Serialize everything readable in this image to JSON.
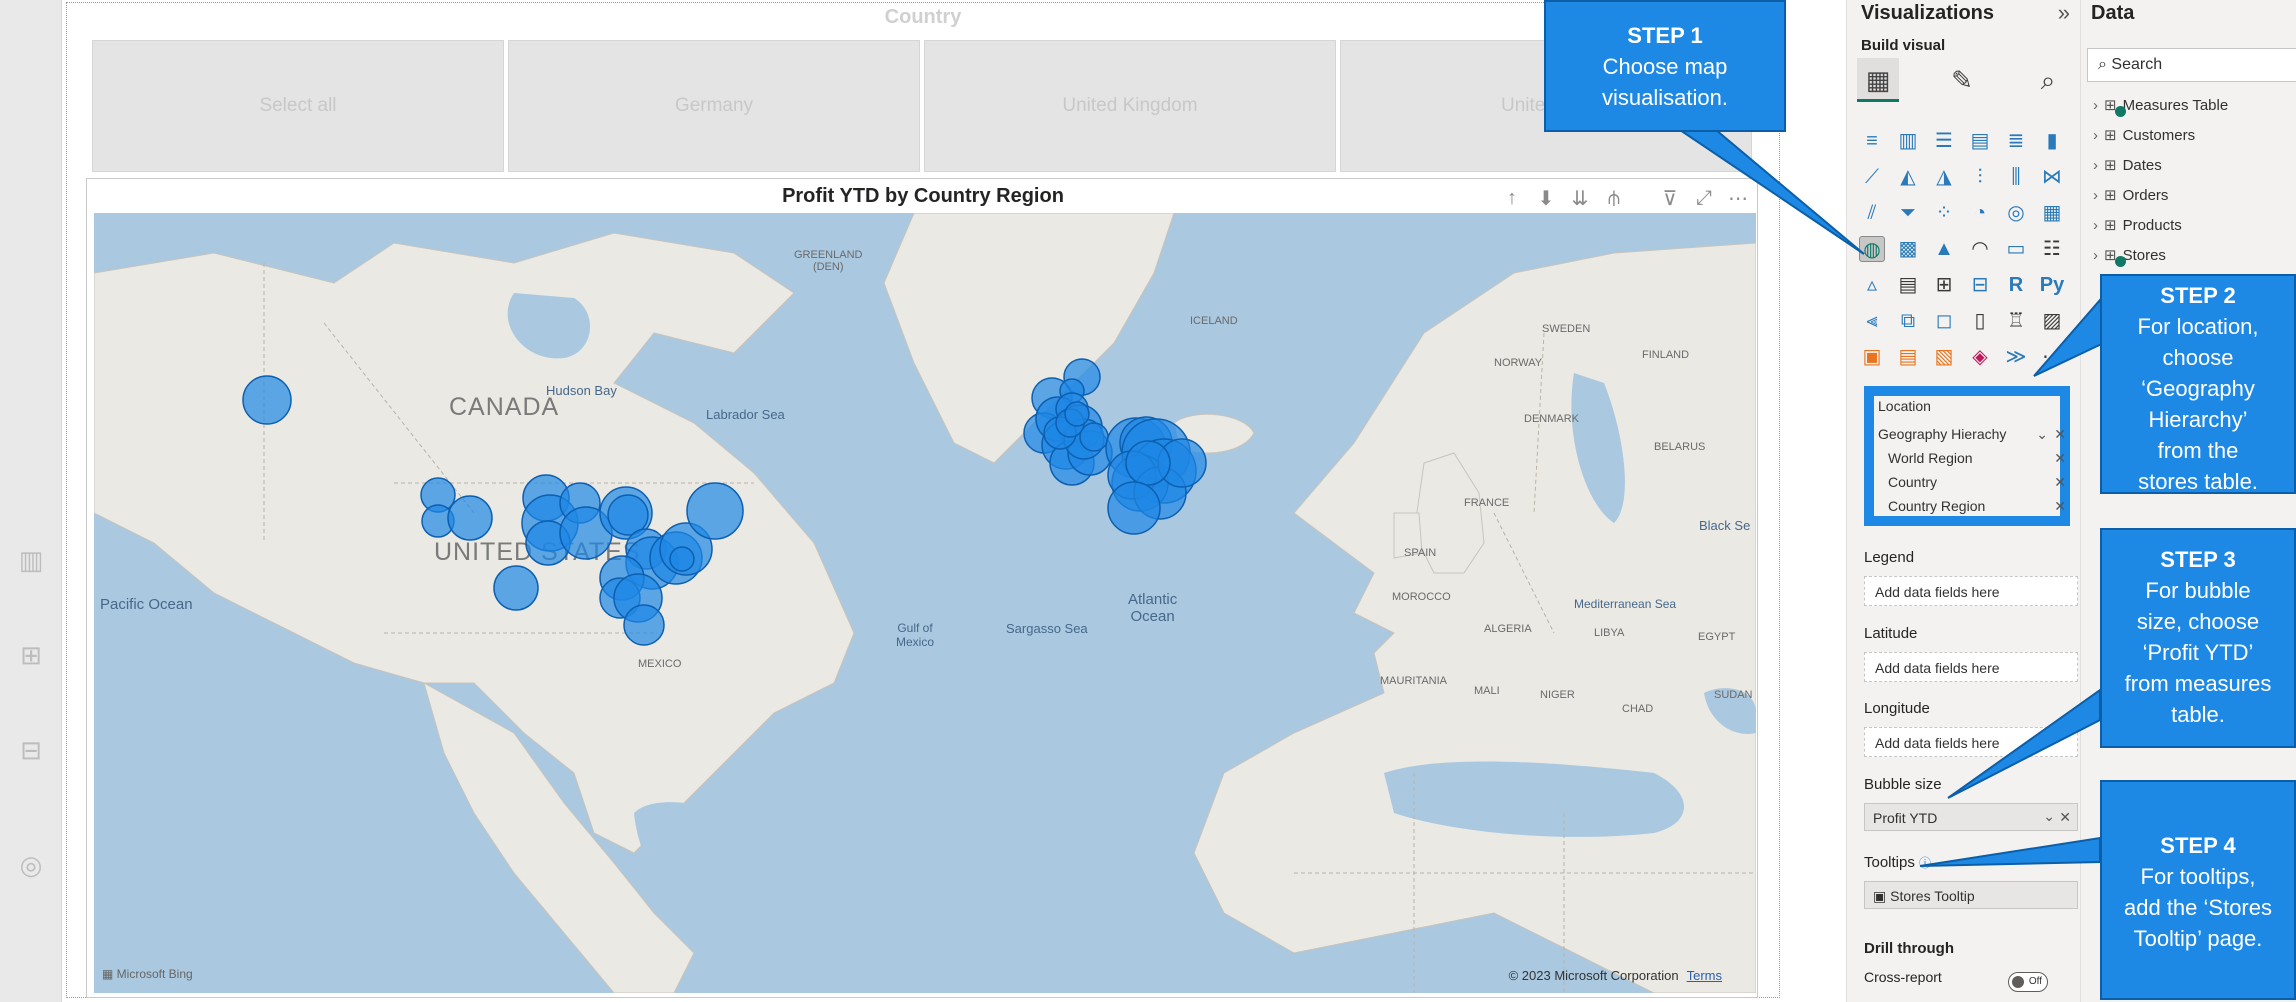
{
  "slicer": {
    "title": "Country",
    "options": [
      "Select all",
      "Germany",
      "United Kingdom",
      "Unite"
    ]
  },
  "visual": {
    "title": "Profit YTD by Country Region",
    "toolbar_icons": [
      "arrow-up-icon",
      "drill-down-icon",
      "expand-next-level-icon",
      "expand-all-icon",
      "filter-icon",
      "focus-mode-icon",
      "more-options-icon"
    ],
    "map": {
      "labels": {
        "canada": "CANADA",
        "united_states": "UNITED STATES",
        "hudson_bay": "Hudson Bay",
        "labrador_sea": "Labrador Sea",
        "greenland": "GREENLAND\n(DEN)",
        "iceland": "ICELAND",
        "sweden": "SWEDEN",
        "finland": "FINLAND",
        "norway": "NORWAY",
        "denmark": "DENMARK",
        "belarus": "BELARUS",
        "france": "FRANCE",
        "spain": "SPAIN",
        "morocco": "MOROCCO",
        "algeria": "ALGERIA",
        "libya": "LIBYA",
        "egypt": "EGYPT",
        "mauritania": "MAURITANIA",
        "mali": "MALI",
        "niger": "NIGER",
        "chad": "CHAD",
        "sudan": "SUDAN",
        "mexico": "MEXICO",
        "gulf_of_mexico": "Gulf of\nMexico",
        "sargasso_sea": "Sargasso Sea",
        "atlantic_ocean": "Atlantic\nOcean",
        "pacific_ocean": "Pacific Ocean",
        "mediterranean_sea": "Mediterranean Sea",
        "black_sea": "Black Se"
      },
      "attribution_left": "Microsoft Bing",
      "attribution_right": "© 2023 Microsoft Corporation",
      "terms": "Terms",
      "bubble_color": "#1e88e5"
    }
  },
  "callouts": [
    {
      "step": "STEP 1",
      "lines": [
        "Choose map",
        "visualisation."
      ]
    },
    {
      "step": "STEP 2",
      "lines": [
        "For location,",
        "choose",
        "‘Geography",
        "Hierarchy’",
        "from the",
        "stores table."
      ]
    },
    {
      "step": "STEP 3",
      "lines": [
        "For bubble",
        "size, choose",
        "‘Profit YTD’",
        "from measures",
        "table."
      ]
    },
    {
      "step": "STEP 4",
      "lines": [
        "For tooltips,",
        "add the ‘Stores",
        "Tooltip’ page."
      ]
    }
  ],
  "visualizations": {
    "header": "Visualizations",
    "build_visual": "Build visual",
    "location_label": "Location",
    "location_fields": [
      "Geography Hierachy",
      "World Region",
      "Country",
      "Country Region"
    ],
    "legend_label": "Legend",
    "latitude_label": "Latitude",
    "longitude_label": "Longitude",
    "placeholder": "Add data fields here",
    "bubble_size_label": "Bubble size",
    "bubble_size_field": "Profit YTD",
    "tooltips_label": "Tooltips",
    "tooltips_field": "Stores Tooltip",
    "drill_through_label": "Drill through",
    "cross_report_label": "Cross-report",
    "cross_report_toggle": "Off",
    "python_label": "Py",
    "r_label": "R"
  },
  "data_pane": {
    "header": "Data",
    "search_placeholder": "Search",
    "tables": [
      "Measures Table",
      "Customers",
      "Dates",
      "Orders",
      "Products",
      "Stores"
    ]
  },
  "colors": {
    "accent": "#1e88e5",
    "callout_border": "#0b5ea8",
    "ocean": "#aac8df",
    "land": "#ebe9e4"
  }
}
